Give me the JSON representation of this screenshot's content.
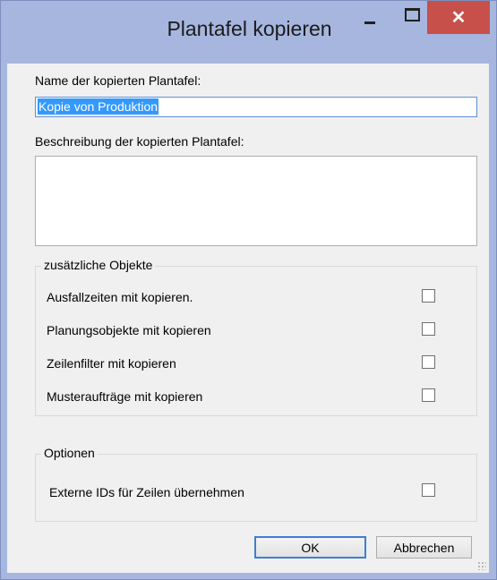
{
  "window": {
    "title": "Plantafel kopieren",
    "close_glyph": "✕"
  },
  "form": {
    "name_label": "Name der kopierten Plantafel:",
    "name_value": "Kopie von Produktion",
    "description_label": "Beschreibung der kopierten Plantafel:",
    "description_value": ""
  },
  "extra_objects": {
    "title": "zusätzliche Objekte",
    "items": [
      {
        "label": "Ausfallzeiten mit kopieren.",
        "checked": false
      },
      {
        "label": "Planungsobjekte mit kopieren",
        "checked": false
      },
      {
        "label": "Zeilenfilter mit kopieren",
        "checked": false
      },
      {
        "label": "Musteraufträge mit kopieren",
        "checked": false
      }
    ]
  },
  "options": {
    "title": "Optionen",
    "items": [
      {
        "label": "Externe IDs für Zeilen übernehmen",
        "checked": false
      }
    ]
  },
  "buttons": {
    "ok": "OK",
    "cancel": "Abbrechen"
  },
  "icons": {
    "minimize": "minimize-icon",
    "maximize": "maximize-icon",
    "close": "close-icon",
    "resize": "resize-grip-icon"
  }
}
